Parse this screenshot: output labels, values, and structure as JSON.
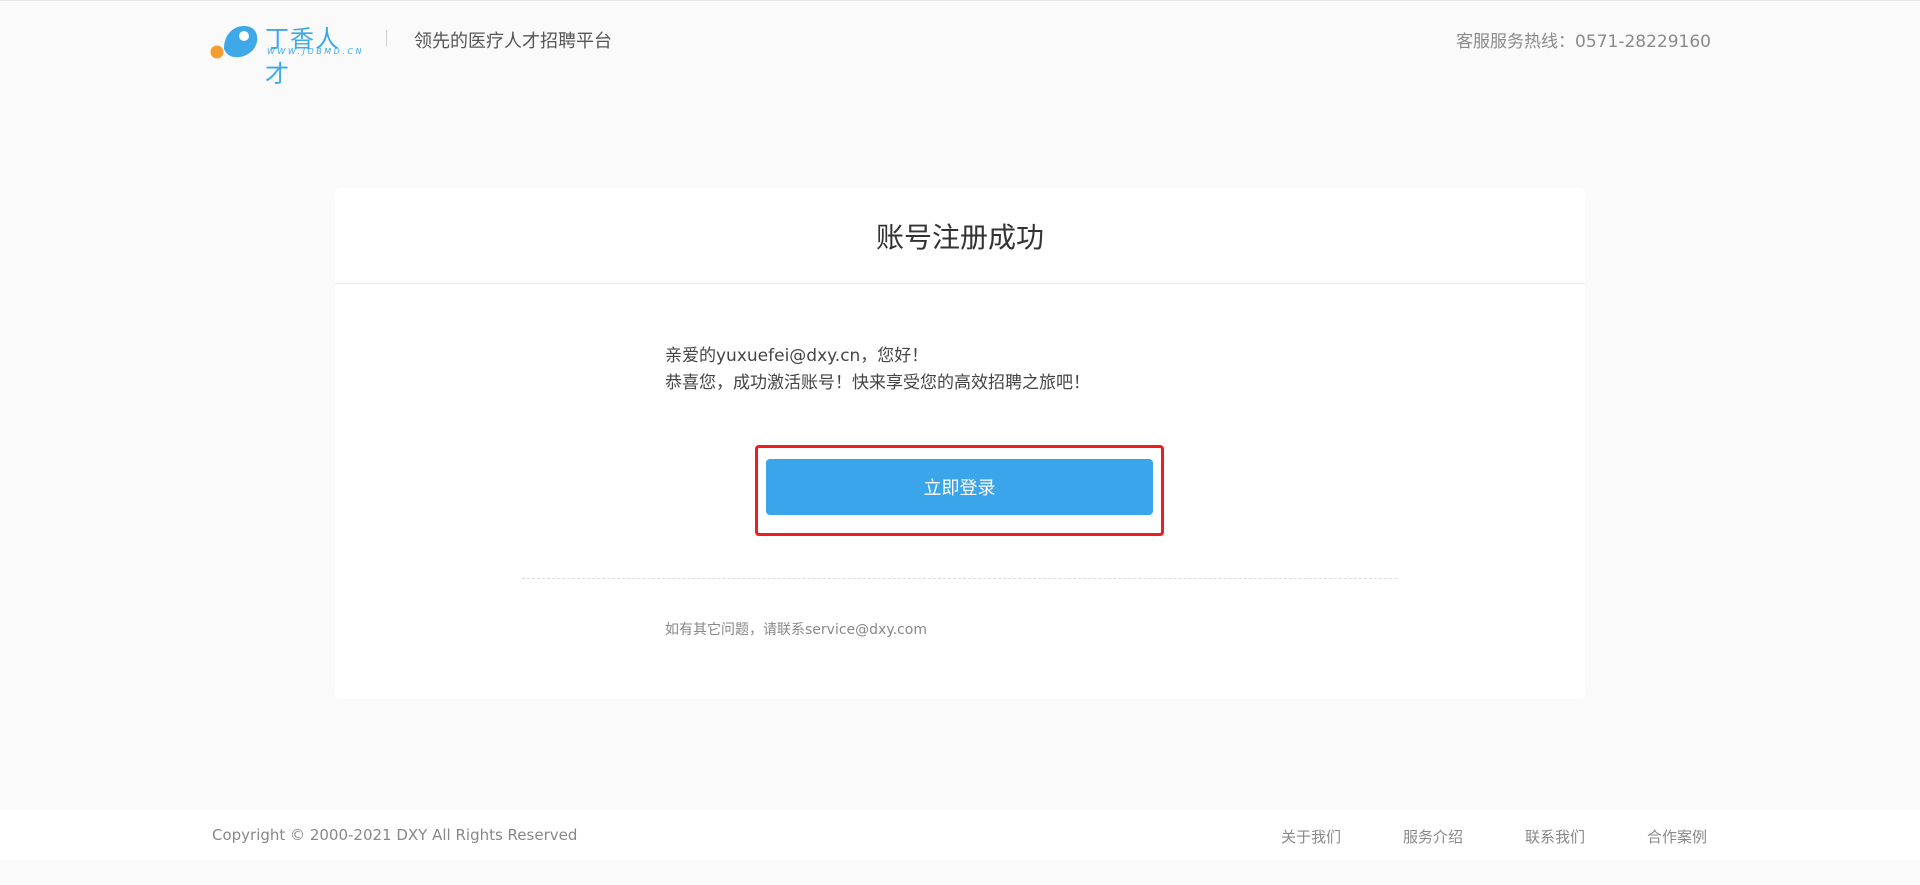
{
  "header": {
    "logo_text": "丁香人才",
    "logo_url": "WWW.JOBMD.CN",
    "slogan": "领先的医疗人才招聘平台",
    "hotline": "客服服务热线：0571-28229160",
    "brand_color": "#3ea9e8",
    "brand_dot_color": "#f39c34"
  },
  "card": {
    "title": "账号注册成功",
    "greeting_line1": "亲爱的yuxuefei@dxy.cn，您好！",
    "greeting_line2": "恭喜您，成功激活账号！快来享受您的高效招聘之旅吧！",
    "login_button_label": "立即登录",
    "button_color": "#3aa5ea",
    "highlight_color": "#ef1d1d",
    "contact_note": "如有其它问题，请联系service@dxy.com"
  },
  "footer": {
    "copyright": "Copyright © 2000-2021 DXY All Rights Reserved",
    "links": [
      "关于我们",
      "服务介绍",
      "联系我们",
      "合作案例"
    ]
  }
}
